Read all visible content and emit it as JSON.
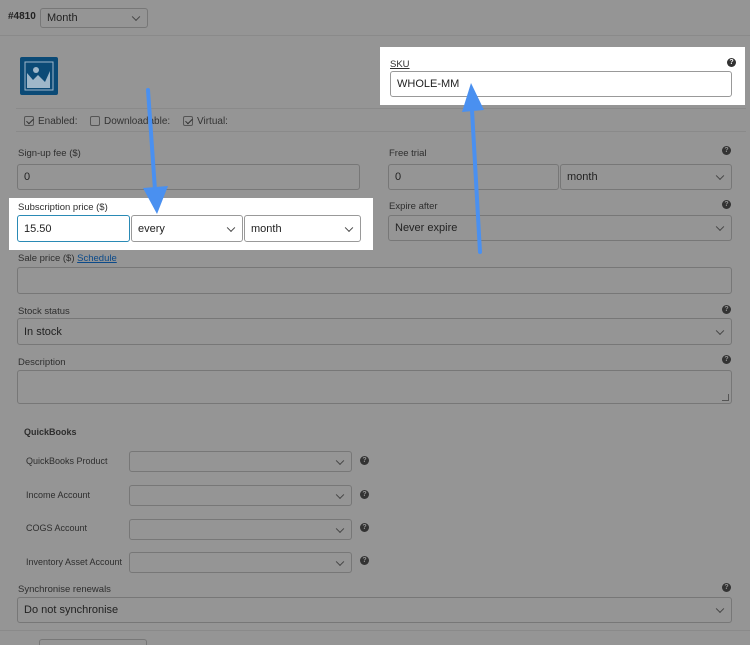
{
  "variation": {
    "id": "#4810",
    "attribute_value": "Month"
  },
  "image_icon": "image-placeholder-icon",
  "checkboxes": [
    {
      "label": "Enabled:",
      "checked": true
    },
    {
      "label": "Downloadable:",
      "checked": false
    },
    {
      "label": "Virtual:",
      "checked": true
    }
  ],
  "sku": {
    "label": "SKU",
    "value": "WHOLE-MM"
  },
  "signup_fee": {
    "label": "Sign-up fee ($)",
    "value": "0"
  },
  "free_trial": {
    "label": "Free trial",
    "value": "0",
    "period": "month"
  },
  "subscription_price": {
    "label": "Subscription price ($)",
    "value": "15.50",
    "interval": "every",
    "period": "month"
  },
  "expire_after": {
    "label": "Expire after",
    "value": "Never expire"
  },
  "sale_price": {
    "label": "Sale price ($)",
    "schedule_link": "Schedule",
    "value": ""
  },
  "stock_status": {
    "label": "Stock status",
    "value": "In stock"
  },
  "description": {
    "label": "Description",
    "value": ""
  },
  "quickbooks": {
    "heading": "QuickBooks",
    "fields": [
      {
        "label": "QuickBooks Product",
        "value": ""
      },
      {
        "label": "Income Account",
        "value": ""
      },
      {
        "label": "COGS Account",
        "value": ""
      },
      {
        "label": "Inventory Asset Account",
        "value": ""
      }
    ]
  },
  "synchronise": {
    "label": "Synchronise renewals",
    "value": "Do not synchronise"
  },
  "help_glyph": "?",
  "colors": {
    "overlay_gray": "#959595",
    "highlight": "#ffffff",
    "arrow": "#4a90f0",
    "icon_blue": "#0b4a76",
    "focus_border": "#2a8ab5"
  }
}
